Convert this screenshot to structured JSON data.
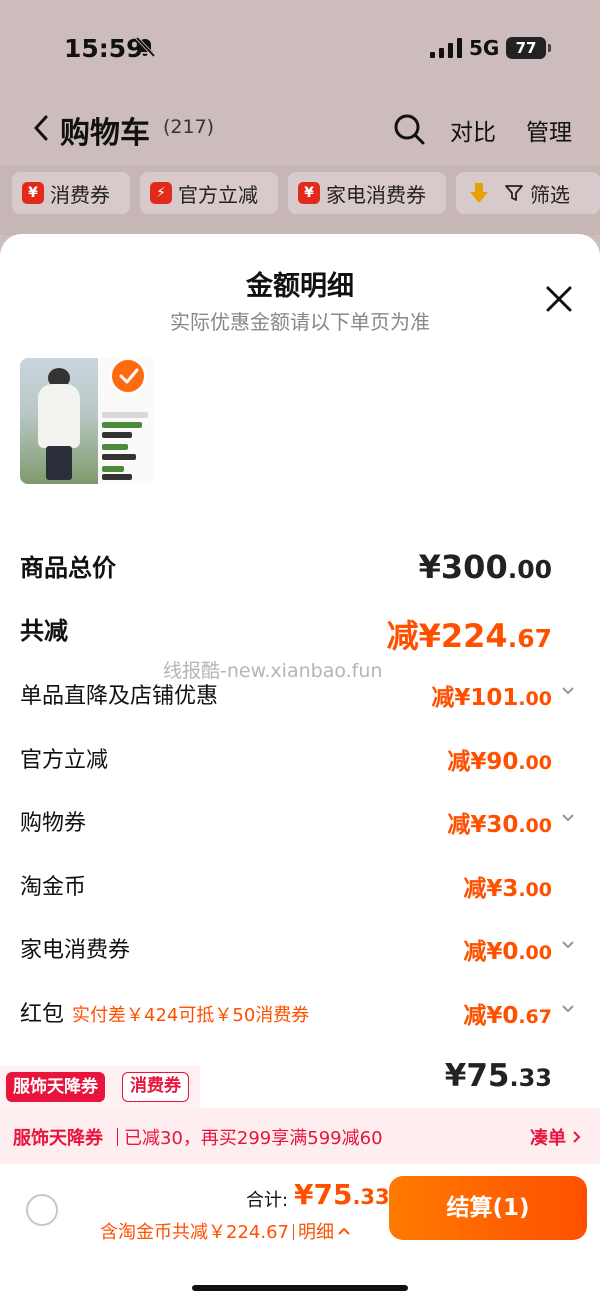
{
  "status_bar": {
    "time": "15:59",
    "network": "5G",
    "battery": "77"
  },
  "navbar": {
    "title": "购物车",
    "count": "(217)",
    "compare": "对比",
    "manage": "管理"
  },
  "filters": [
    {
      "label": "消费券",
      "icon": "¥"
    },
    {
      "label": "官方立减",
      "icon": "⚡"
    },
    {
      "label": "家电消费券",
      "icon": "¥"
    },
    {
      "label": "筛选"
    }
  ],
  "sheet": {
    "title": "金额明细",
    "subtitle": "实际优惠金额请以下单页为准",
    "watermark": "线报酷-new.xianbao.fun",
    "product_total": {
      "label": "商品总价",
      "int": "¥300",
      "dec": ".00"
    },
    "total_discount": {
      "label": "共减",
      "int": "减¥224",
      "dec": ".67"
    },
    "items": [
      {
        "label": "单品直降及店铺优惠",
        "int": "减¥101",
        "dec": ".00",
        "has_chevron": true
      },
      {
        "label": "官方立减",
        "int": "减¥90",
        "dec": ".00",
        "has_chevron": false
      },
      {
        "label": "购物券",
        "int": "减¥30",
        "dec": ".00",
        "has_chevron": true
      },
      {
        "label": "淘金币",
        "int": "减¥3",
        "dec": ".00",
        "has_chevron": false
      },
      {
        "label": "家电消费券",
        "int": "减¥0",
        "dec": ".00",
        "has_chevron": true
      },
      {
        "label": "红包",
        "sub": "实付差￥424可抵￥50消费券",
        "int": "减¥0",
        "dec": ".67",
        "has_chevron": true
      }
    ],
    "total": {
      "label": "合计",
      "int": "¥75",
      "dec": ".33"
    }
  },
  "promo": {
    "tag1": "服饰天降券",
    "tag2": "消费券",
    "name": "服饰天降券",
    "text": "已减30，再买299享满599减60",
    "action": "凑单"
  },
  "checkout": {
    "sum_label": "合计:",
    "sum_int": "¥75",
    "sum_dec": ".33",
    "detail_text": "含淘金币共减￥224.67",
    "detail_link": "明细",
    "button": "结算(1)"
  },
  "colors": {
    "accent": "#ff5000",
    "promo_red": "#e8143c"
  }
}
